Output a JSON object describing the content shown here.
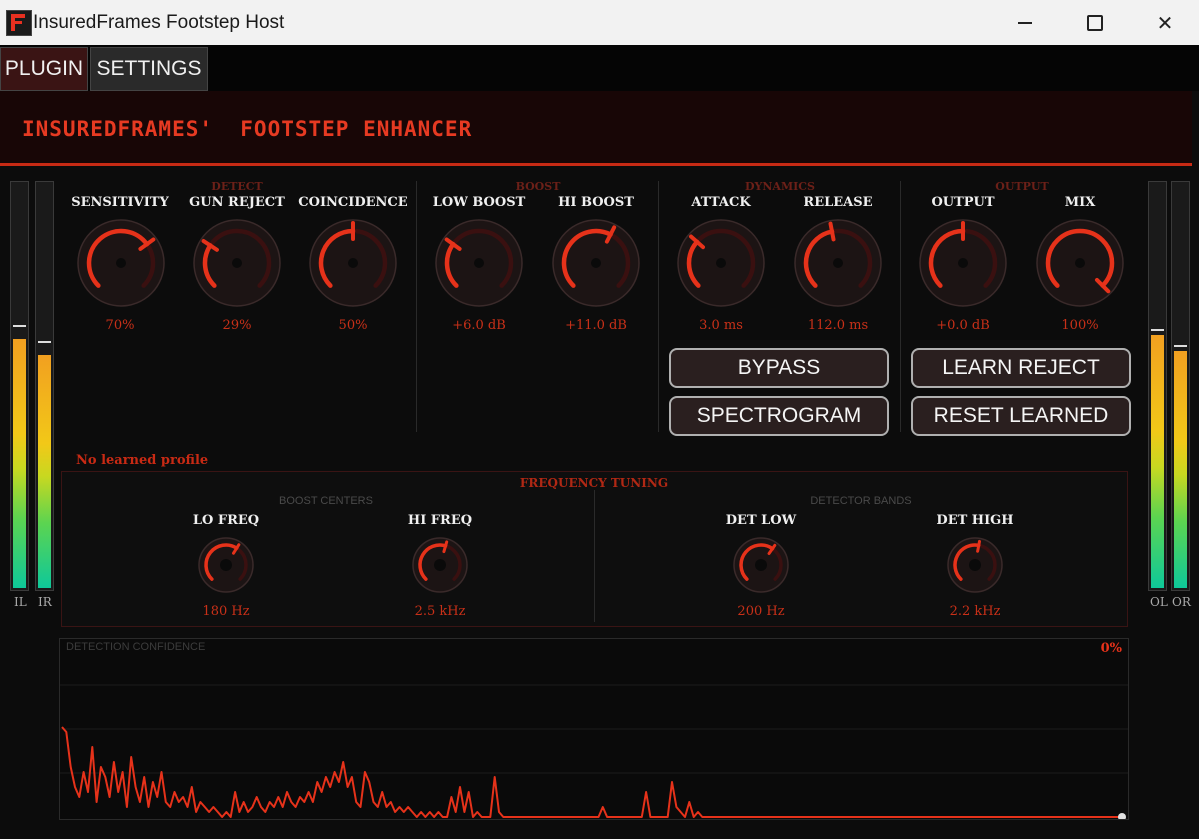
{
  "window": {
    "title": "InsuredFrames Footstep Host",
    "minimize_icon": "minimize-icon",
    "maximize_icon": "maximize-icon",
    "close_icon": "close-icon"
  },
  "tabs": [
    {
      "label": "PLUGIN",
      "active": true
    },
    {
      "label": "SETTINGS",
      "active": false
    }
  ],
  "header": {
    "title": "INSUREDFRAMES'  FOOTSTEP ENHANCER"
  },
  "groups": {
    "detect": "DETECT",
    "boost": "BOOST",
    "dynamics": "DYNAMICS",
    "output": "OUTPUT"
  },
  "knobs": [
    {
      "label": "SENSITIVITY",
      "value": "70%",
      "level": 0.7
    },
    {
      "label": "GUN REJECT",
      "value": "29%",
      "level": 0.29
    },
    {
      "label": "COINCIDENCE",
      "value": "50%",
      "level": 0.5
    },
    {
      "label": "LOW BOOST",
      "value": "+6.0 dB",
      "level": 0.3
    },
    {
      "label": "HI BOOST",
      "value": "+11.0 dB",
      "level": 0.6
    },
    {
      "label": "ATTACK",
      "value": "3.0 ms",
      "level": 0.32
    },
    {
      "label": "RELEASE",
      "value": "112.0 ms",
      "level": 0.46
    },
    {
      "label": "OUTPUT",
      "value": "+0.0 dB",
      "level": 0.5
    },
    {
      "label": "MIX",
      "value": "100%",
      "level": 1.0
    }
  ],
  "buttons": {
    "bypass": "BYPASS",
    "spectrogram": "SPECTROGRAM",
    "learn_reject": "LEARN REJECT",
    "reset_learned": "RESET LEARNED"
  },
  "profile_status": "No learned profile",
  "frequency": {
    "title": "FREQUENCY TUNING",
    "boost_centers": "BOOST CENTERS",
    "detector_bands": "DETECTOR BANDS",
    "knobs": [
      {
        "label": "LO FREQ",
        "value": "180 Hz",
        "level": 0.62
      },
      {
        "label": "HI FREQ",
        "value": "2.5 kHz",
        "level": 0.56
      },
      {
        "label": "DET LOW",
        "value": "200 Hz",
        "level": 0.63
      },
      {
        "label": "DET HIGH",
        "value": "2.2 kHz",
        "level": 0.54
      }
    ]
  },
  "meters": {
    "input": [
      {
        "label": "IL",
        "level": 0.62,
        "peak": 0.65
      },
      {
        "label": "IR",
        "level": 0.58,
        "peak": 0.61
      }
    ],
    "output": [
      {
        "label": "OL",
        "level": 0.63,
        "peak": 0.64
      },
      {
        "label": "OR",
        "level": 0.59,
        "peak": 0.6
      }
    ]
  },
  "confidence": {
    "label": "DETECTION CONFIDENCE",
    "value": "0%",
    "series": [
      0.18,
      0.17,
      0.1,
      0.06,
      0.04,
      0.09,
      0.05,
      0.14,
      0.03,
      0.1,
      0.08,
      0.04,
      0.11,
      0.05,
      0.09,
      0.02,
      0.12,
      0.06,
      0.03,
      0.08,
      0.02,
      0.07,
      0.04,
      0.09,
      0.03,
      0.02,
      0.05,
      0.03,
      0.04,
      0.02,
      0.06,
      0.01,
      0.03,
      0.02,
      0.01,
      0.02,
      0.01,
      0.0,
      0.01,
      0.0,
      0.05,
      0.01,
      0.03,
      0.01,
      0.02,
      0.04,
      0.02,
      0.01,
      0.03,
      0.02,
      0.04,
      0.02,
      0.05,
      0.03,
      0.02,
      0.04,
      0.03,
      0.05,
      0.03,
      0.07,
      0.05,
      0.08,
      0.06,
      0.09,
      0.07,
      0.11,
      0.06,
      0.08,
      0.03,
      0.02,
      0.09,
      0.07,
      0.03,
      0.02,
      0.05,
      0.02,
      0.03,
      0.01,
      0.02,
      0.01,
      0.02,
      0.01,
      0.0,
      0.01,
      0.0,
      0.01,
      0.0,
      0.01,
      0.0,
      0.0,
      0.04,
      0.01,
      0.06,
      0.01,
      0.05,
      0.0,
      0.01,
      0.0,
      0.0,
      0.0,
      0.08,
      0.01,
      0.0,
      0.0,
      0.0,
      0.0,
      0.0,
      0.0,
      0.0,
      0.0,
      0.0,
      0.0,
      0.0,
      0.0,
      0.0,
      0.0,
      0.0,
      0.0,
      0.0,
      0.0,
      0.0,
      0.0,
      0.0,
      0.0,
      0.0,
      0.02,
      0.0,
      0.0,
      0.0,
      0.0,
      0.0,
      0.0,
      0.0,
      0.0,
      0.0,
      0.05,
      0.0,
      0.0,
      0.0,
      0.0,
      0.0,
      0.07,
      0.02,
      0.01,
      0.0,
      0.03,
      0.0,
      0.01,
      0.0,
      0.0,
      0.0,
      0.0,
      0.0,
      0.0,
      0.0,
      0.0,
      0.0,
      0.0,
      0.0,
      0.0,
      0.0,
      0.0,
      0.0,
      0.0,
      0.0,
      0.0,
      0.0,
      0.0,
      0.0,
      0.0,
      0.0,
      0.0,
      0.0,
      0.0,
      0.0,
      0.0,
      0.0,
      0.0,
      0.0,
      0.0,
      0.0,
      0.0,
      0.0,
      0.0,
      0.0,
      0.0,
      0.0,
      0.0,
      0.0,
      0.0,
      0.0,
      0.0,
      0.0,
      0.0,
      0.0,
      0.0,
      0.0,
      0.0,
      0.0,
      0.0,
      0.0,
      0.0,
      0.0,
      0.0,
      0.0,
      0.0,
      0.0,
      0.0,
      0.0,
      0.0,
      0.0,
      0.0,
      0.0,
      0.0,
      0.0,
      0.0,
      0.0,
      0.0,
      0.0,
      0.0,
      0.0,
      0.0,
      0.0,
      0.0,
      0.0,
      0.0,
      0.0,
      0.0,
      0.0,
      0.0,
      0.0,
      0.0,
      0.0,
      0.0,
      0.0,
      0.0,
      0.0,
      0.0,
      0.0,
      0.0,
      0.0,
      0.0,
      0.0,
      0.0,
      0.0,
      0.0
    ]
  },
  "colors": {
    "accent": "#e6321a",
    "header_bg": "#180606",
    "panel_bg": "#0c0c0c",
    "knob_track": "#3a1010",
    "knob_body": "#1c1414"
  }
}
